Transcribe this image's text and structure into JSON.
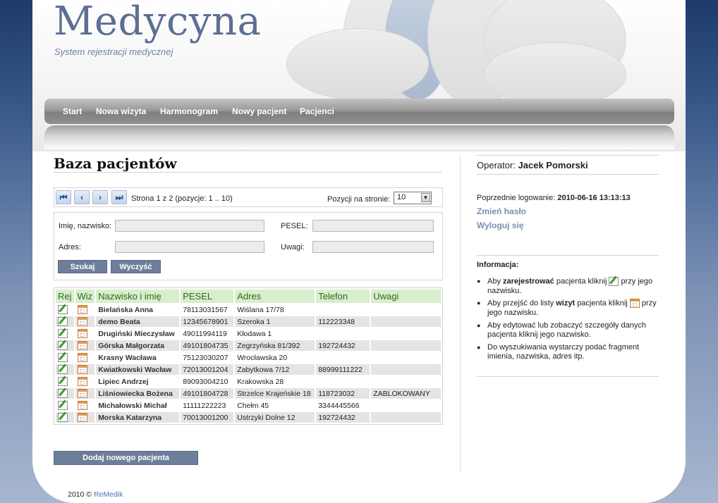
{
  "header": {
    "title": "Medycyna",
    "subtitle": "System rejestracji medycznej"
  },
  "nav": {
    "items": [
      {
        "label": "Start"
      },
      {
        "label": "Nowa wizyta"
      },
      {
        "label": "Harmonogram"
      },
      {
        "label": "Nowy pacjent"
      },
      {
        "label": "Pacjenci"
      }
    ]
  },
  "main": {
    "title": "Baza pacjentów",
    "pager": {
      "status": "Strona 1 z 2 (pozycje: 1 .. 10)",
      "per_page_label": "Pozycji na stronie:",
      "per_page_value": "10"
    },
    "filter": {
      "name_label": "Imię, nazwisko:",
      "pesel_label": "PESEL:",
      "address_label": "Adres:",
      "notes_label": "Uwagi:",
      "name_value": "",
      "pesel_value": "",
      "address_value": "",
      "notes_value": "",
      "search_button": "Szukaj",
      "clear_button": "Wyczyść"
    },
    "table": {
      "headers": [
        "Rej",
        "Wiz",
        "Nazwisko i imię",
        "PESEL",
        "Adres",
        "Telefon",
        "Uwagi"
      ],
      "rows": [
        {
          "name": "Bielańska Anna",
          "pesel": "78113031567",
          "address": "Wiślana 17/78",
          "phone": "",
          "notes": ""
        },
        {
          "name": "demo Beata",
          "pesel": "12345678901",
          "address": "Szeroka 1",
          "phone": "112223348",
          "notes": ""
        },
        {
          "name": "Drugiński Mieczysław",
          "pesel": "49011994119",
          "address": "Kłodawa 1",
          "phone": "",
          "notes": ""
        },
        {
          "name": "Górska Małgorzata",
          "pesel": "49101804735",
          "address": "Zegrzyńska 81/392",
          "phone": "192724432",
          "notes": ""
        },
        {
          "name": "Krasny Wacława",
          "pesel": "75123030207",
          "address": "Wrocławska 20",
          "phone": "",
          "notes": ""
        },
        {
          "name": "Kwiatkowski Wacław",
          "pesel": "72013001204",
          "address": "Zabytkowa 7/12",
          "phone": "88999111222",
          "notes": ""
        },
        {
          "name": "Lipiec Andrzej",
          "pesel": "89093004210",
          "address": "Krakowska 28",
          "phone": "",
          "notes": ""
        },
        {
          "name": "Liśniowiecka Bożena",
          "pesel": "49101804728",
          "address": "Strzelce Krajeńskie 18",
          "phone": "118723032",
          "notes": "ZABLOKOWANY"
        },
        {
          "name": "Michałowski Michał",
          "pesel": "11111222223",
          "address": "Chełm 45",
          "phone": "3344445566",
          "notes": ""
        },
        {
          "name": "Morska Katarzyna",
          "pesel": "70013001200",
          "address": "Ustrzyki Dolne 12",
          "phone": "192724432",
          "notes": ""
        }
      ]
    },
    "add_button": "Dodaj nowego pacjenta"
  },
  "sidebar": {
    "operator_label": "Operator:",
    "operator_name": "Jacek Pomorski",
    "last_login_label": "Poprzednie logowanie:",
    "last_login_value": "2010-06-16 13:13:13",
    "change_password": "Zmień hasło",
    "logout": "Wyloguj się",
    "info_title": "Informacja:",
    "info": {
      "i1_pre": "Aby",
      "i1_bold": "zarejestrować",
      "i1_mid": "pacjenta kliknij",
      "i1_post": "przy jego nazwisku.",
      "i2_pre": "Aby przejść do listy",
      "i2_bold": "wizyt",
      "i2_mid": "pacjenta kliknij",
      "i2_post": "przy jego nazwisku.",
      "i3": "Aby edytować lub zobaczyć szczegóły danych pacjenta kliknij jego nazwisko.",
      "i4": "Do wyszukiwania wystarczy podać fragment imienia, nazwiska, adres itp."
    }
  },
  "footer": {
    "year": "2010 ©",
    "link": "ReMedik"
  }
}
